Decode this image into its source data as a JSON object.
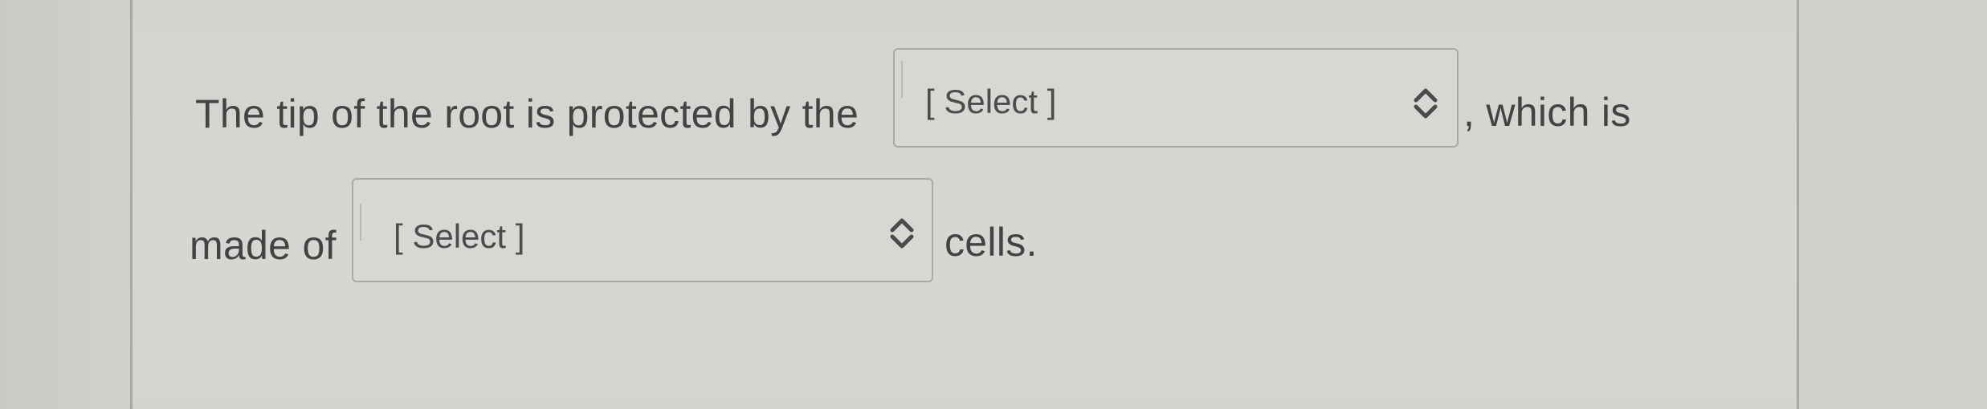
{
  "question": {
    "text_part1": "The tip of the root is protected by the",
    "text_part2": ", which is",
    "text_part3": "made of",
    "text_part4": "cells."
  },
  "dropdowns": [
    {
      "selected_label": "[ Select ]"
    },
    {
      "selected_label": "[ Select ]"
    }
  ],
  "icons": {
    "dropdown_chevron": "chevron-up-down-icon"
  }
}
